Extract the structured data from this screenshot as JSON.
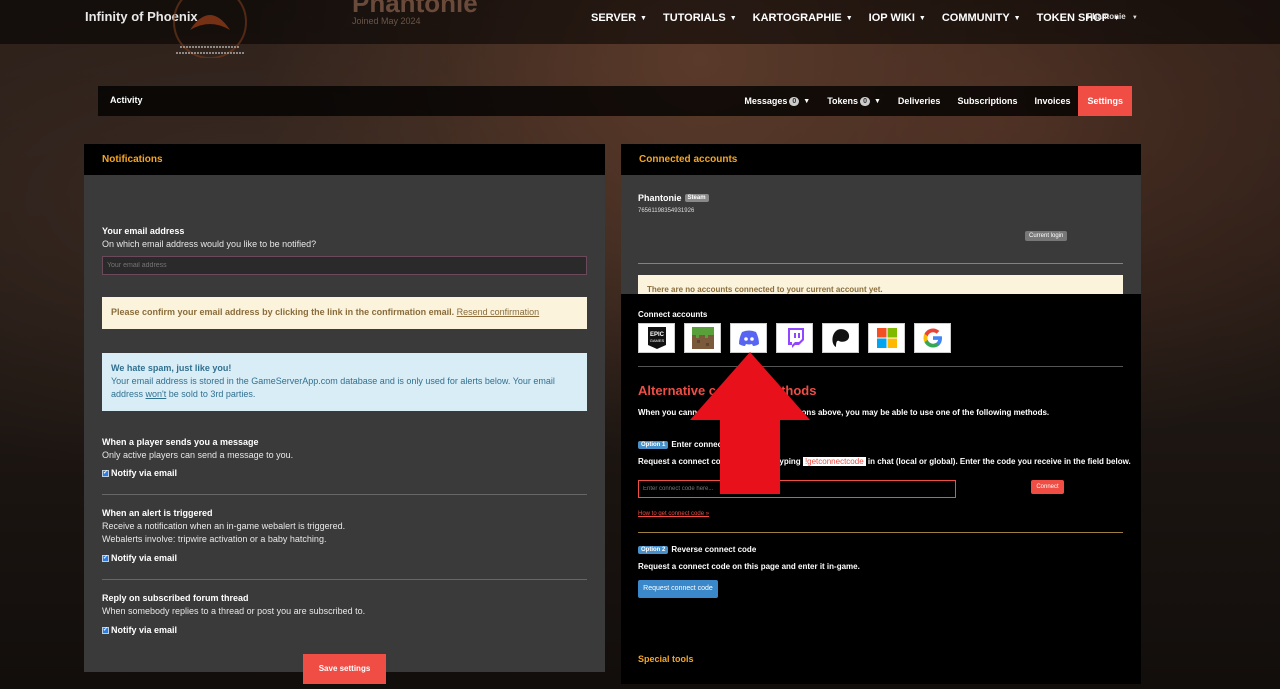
{
  "site": {
    "brand": "Infinity of Phoenix",
    "profile_name": "Phantonie",
    "joined": "Joined May 2024"
  },
  "topnav": {
    "items": [
      {
        "label": "SERVER"
      },
      {
        "label": "TUTORIALS"
      },
      {
        "label": "KARTOGRAPHIE"
      },
      {
        "label": "IOP WIKI"
      },
      {
        "label": "COMMUNITY"
      },
      {
        "label": "TOKEN SHOP"
      }
    ],
    "user": "Phantonie"
  },
  "subnav": {
    "activity": "Activity",
    "messages": "Messages",
    "messages_count": "0",
    "tokens": "Tokens",
    "tokens_count": "0",
    "deliveries": "Deliveries",
    "subscriptions": "Subscriptions",
    "invoices": "Invoices",
    "settings": "Settings"
  },
  "notifications": {
    "header": "Notifications",
    "email_label": "Your email address",
    "email_desc": "On which email address would you like to be notified?",
    "email_placeholder": "Your email address",
    "confirm_text": "Please confirm your email address by clicking the link in the confirmation email.",
    "confirm_link": "Resend confirmation",
    "spam_title": "We hate spam, just like you!",
    "spam_text": "Your email address is stored in the GameServerApp.com database and is only used for alerts below. Your email address",
    "spam_link": "won't",
    "spam_text2": "be sold to 3rd parties.",
    "msg_label": "When a player sends you a message",
    "msg_desc": "Only active players can send a message to you.",
    "notify_label": "Notify via email",
    "alert_label": "When an alert is triggered",
    "alert_desc1": "Receive a notification when an in-game webalert is triggered.",
    "alert_desc2": "Webalerts involve: tripwire activation or a baby hatching.",
    "forum_label": "Reply on subscribed forum thread",
    "forum_desc": "When somebody replies to a thread or post you are subscribed to.",
    "save": "Save settings"
  },
  "connected": {
    "header": "Connected accounts",
    "account_name": "Phantonie",
    "account_platform": "Steam",
    "account_id": "76561198354931926",
    "current_login": "Current login",
    "no_accounts": "There are no accounts connected to your current account yet.",
    "connect_label": "Connect accounts",
    "providers": [
      "epic-games",
      "minecraft",
      "discord",
      "twitch",
      "patreon",
      "microsoft",
      "google"
    ],
    "alt_title": "Alternative connect methods",
    "alt_text": "When you cannot connect through the buttons above, you may be able to use one of the following methods.",
    "opt1_badge": "Option 1",
    "opt1_title": "Enter connect code",
    "opt1_desc_a": "Request a connect code in-game by typing",
    "opt1_cmd": "!getconnectcode",
    "opt1_desc_b": "in chat (local or global). Enter the code you receive in the field below.",
    "code_placeholder": "Enter connect code here...",
    "connect_btn": "Connect",
    "howto": "How to get connect code »",
    "opt2_badge": "Option 2",
    "opt2_title": "Reverse connect code",
    "opt2_desc": "Request a connect code on this page and enter it in-game.",
    "request_btn": "Request connect code",
    "special": "Special tools"
  },
  "colors": {
    "accent": "#f04d45",
    "header_text": "#f5a623",
    "panel_bg": "#3a3a3a"
  }
}
